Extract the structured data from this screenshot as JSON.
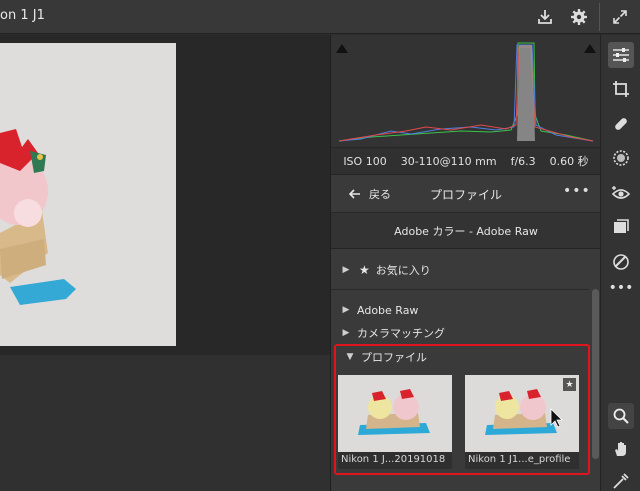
{
  "window": {
    "title": "on 1 J1"
  },
  "toolbar": {
    "export_icon": "save-icon",
    "settings_icon": "gear-icon",
    "expand_icon": "expand-icon"
  },
  "camera_info": {
    "iso": "ISO 100",
    "lens": "30-110@110 mm",
    "aperture": "f/6.3",
    "shutter": "0.60 秒"
  },
  "profile_panel": {
    "back_label": "戻る",
    "title": "プロファイル",
    "more_label": "•••",
    "current_profile": "Adobe カラー - Adobe Raw",
    "groups": [
      {
        "label": "お気に入り",
        "star": "★"
      },
      {
        "label": "Adobe Raw"
      },
      {
        "label": "カメラマッチング"
      },
      {
        "label": "プロファイル"
      }
    ],
    "profiles": [
      {
        "caption": "Nikon 1 J...20191018"
      },
      {
        "caption": "Nikon 1 J1...e_profile",
        "favorite_badge": "★"
      }
    ]
  },
  "colors": {
    "highlight": "#e0141e",
    "panel_bg": "#3a3a3a"
  }
}
